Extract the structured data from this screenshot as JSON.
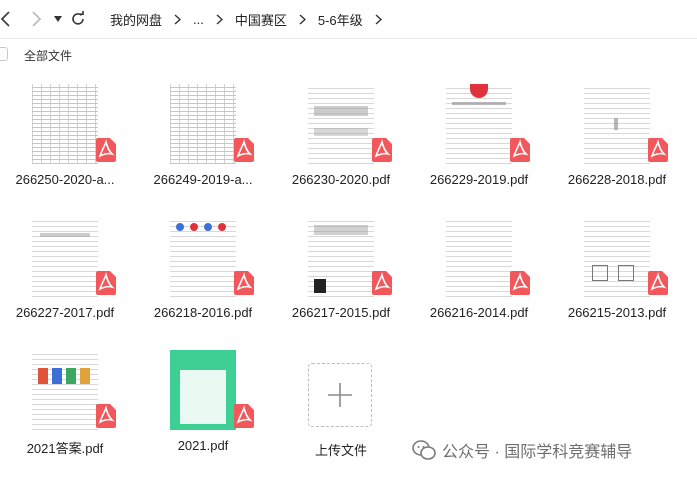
{
  "toolbar": {
    "back_icon": "chevron-left-icon",
    "forward_icon": "chevron-right-icon",
    "history_icon": "caret-down-icon",
    "refresh_icon": "refresh-icon",
    "breadcrumb": [
      "我的网盘",
      "...",
      "中国赛区",
      "5-6年级"
    ]
  },
  "select_all_label": "全部文件",
  "files": [
    {
      "name": "266250-2020-a...",
      "type": "pdf",
      "thumb": "grid"
    },
    {
      "name": "266249-2019-a...",
      "type": "pdf",
      "thumb": "grid"
    },
    {
      "name": "266230-2020.pdf",
      "type": "pdf",
      "thumb": "text"
    },
    {
      "name": "266229-2019.pdf",
      "type": "pdf",
      "thumb": "text"
    },
    {
      "name": "266228-2018.pdf",
      "type": "pdf",
      "thumb": "text"
    },
    {
      "name": "266227-2017.pdf",
      "type": "pdf",
      "thumb": "text"
    },
    {
      "name": "266218-2016.pdf",
      "type": "pdf",
      "thumb": "text"
    },
    {
      "name": "266217-2015.pdf",
      "type": "pdf",
      "thumb": "text"
    },
    {
      "name": "266216-2014.pdf",
      "type": "pdf",
      "thumb": "text"
    },
    {
      "name": "266215-2013.pdf",
      "type": "pdf",
      "thumb": "text"
    },
    {
      "name": "2021答案.pdf",
      "type": "pdf",
      "thumb": "text"
    },
    {
      "name": "2021.pdf",
      "type": "pdf",
      "thumb": "cover"
    }
  ],
  "upload_label": "上传文件",
  "watermark": "公众号 · 国际学科竞赛辅导",
  "colors": {
    "pdf_badge": "#f2585b",
    "cover": "#3ecf95",
    "accent": "#222222"
  }
}
